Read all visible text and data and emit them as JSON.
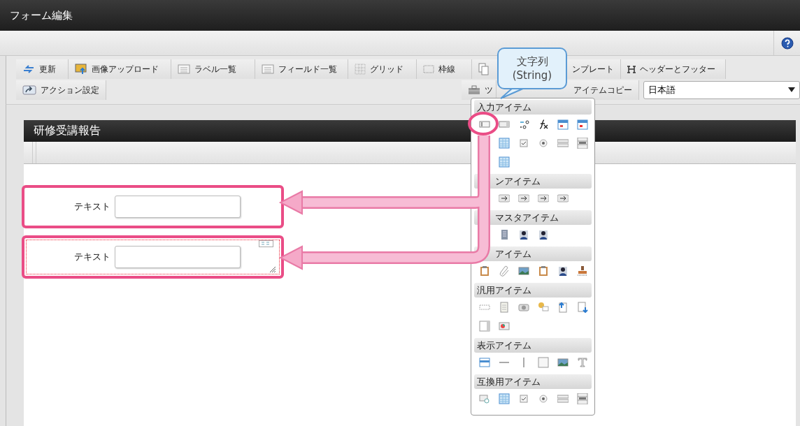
{
  "window": {
    "title": "フォーム編集"
  },
  "toolbar": {
    "row_1": [
      {
        "label": "更新"
      },
      {
        "label": "画像アップロード"
      },
      {
        "label": "ラベル一覧"
      },
      {
        "label": "フィールド一覧"
      },
      {
        "label": "グリッド"
      },
      {
        "label": "枠線"
      },
      {
        "label": "ンプレート"
      },
      {
        "label": "ヘッダーとフッター"
      }
    ],
    "row_2_left": [
      {
        "label": "アクション設定"
      }
    ],
    "row_2_right": [
      {
        "label": "ツ"
      },
      {
        "label": "アイテムコピー"
      }
    ],
    "language": {
      "value": "日本語"
    }
  },
  "tooltip": {
    "lines": [
      "文字列",
      "(String)"
    ]
  },
  "form": {
    "title": "研修受講報告",
    "fields": [
      {
        "label": "テキスト",
        "selected": false
      },
      {
        "label": "テキスト",
        "selected": true
      }
    ]
  },
  "palette": {
    "sections": [
      {
        "heading": "入力アイテム"
      },
      {
        "heading": "ンアイテム"
      },
      {
        "heading": "マスタアイテム"
      },
      {
        "heading": "アイテム"
      },
      {
        "heading": "汎用アイテム"
      },
      {
        "heading": "表示アイテム"
      },
      {
        "heading": "互換用アイテム"
      }
    ]
  }
}
